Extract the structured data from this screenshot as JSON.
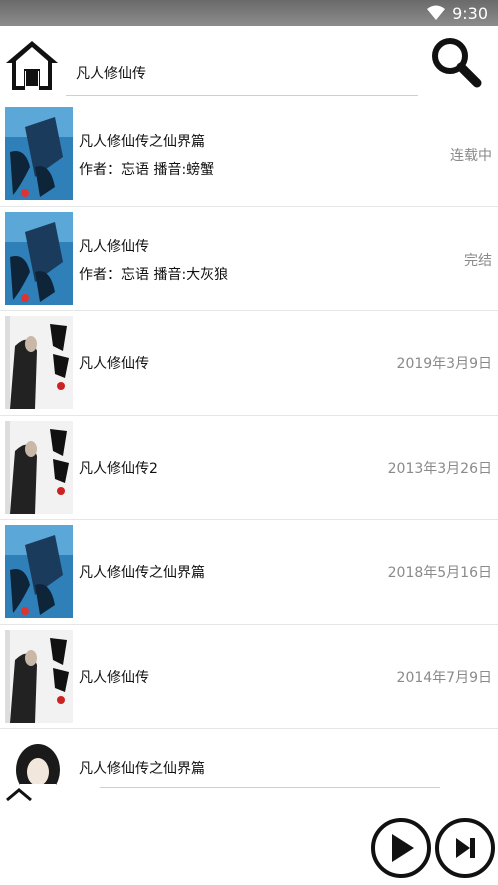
{
  "status_bar": {
    "time": "9:30",
    "wifi_icon": "wifi-icon"
  },
  "header": {
    "home_icon": "home-icon",
    "search_value": "凡人修仙传",
    "search_icon": "search-icon"
  },
  "list": [
    {
      "title": "凡人修仙传之仙界篇",
      "meta": "作者：忘语   播音:螃蟹",
      "status": "连载中",
      "cover": "blue"
    },
    {
      "title": "凡人修仙传",
      "meta": "作者：忘语   播音:大灰狼",
      "status": "完结",
      "cover": "blue"
    },
    {
      "title": "凡人修仙传",
      "meta": "",
      "status": "2019年3月9日",
      "cover": "bw"
    },
    {
      "title": "凡人修仙传2",
      "meta": "",
      "status": "2013年3月26日",
      "cover": "bw"
    },
    {
      "title": "凡人修仙传之仙界篇",
      "meta": "",
      "status": "2018年5月16日",
      "cover": "blue"
    },
    {
      "title": "凡人修仙传",
      "meta": "",
      "status": "2014年7月9日",
      "cover": "bw"
    }
  ],
  "now_playing": {
    "title": "凡人修仙传之仙界篇"
  },
  "controls": {
    "collapse_icon": "chevron-up-icon",
    "play_icon": "play-icon",
    "next_icon": "skip-next-icon"
  },
  "colors": {
    "status_gray": "#8a8a8a",
    "cover_blue": "#2f7fb8",
    "divider": "#e6e6e6"
  }
}
